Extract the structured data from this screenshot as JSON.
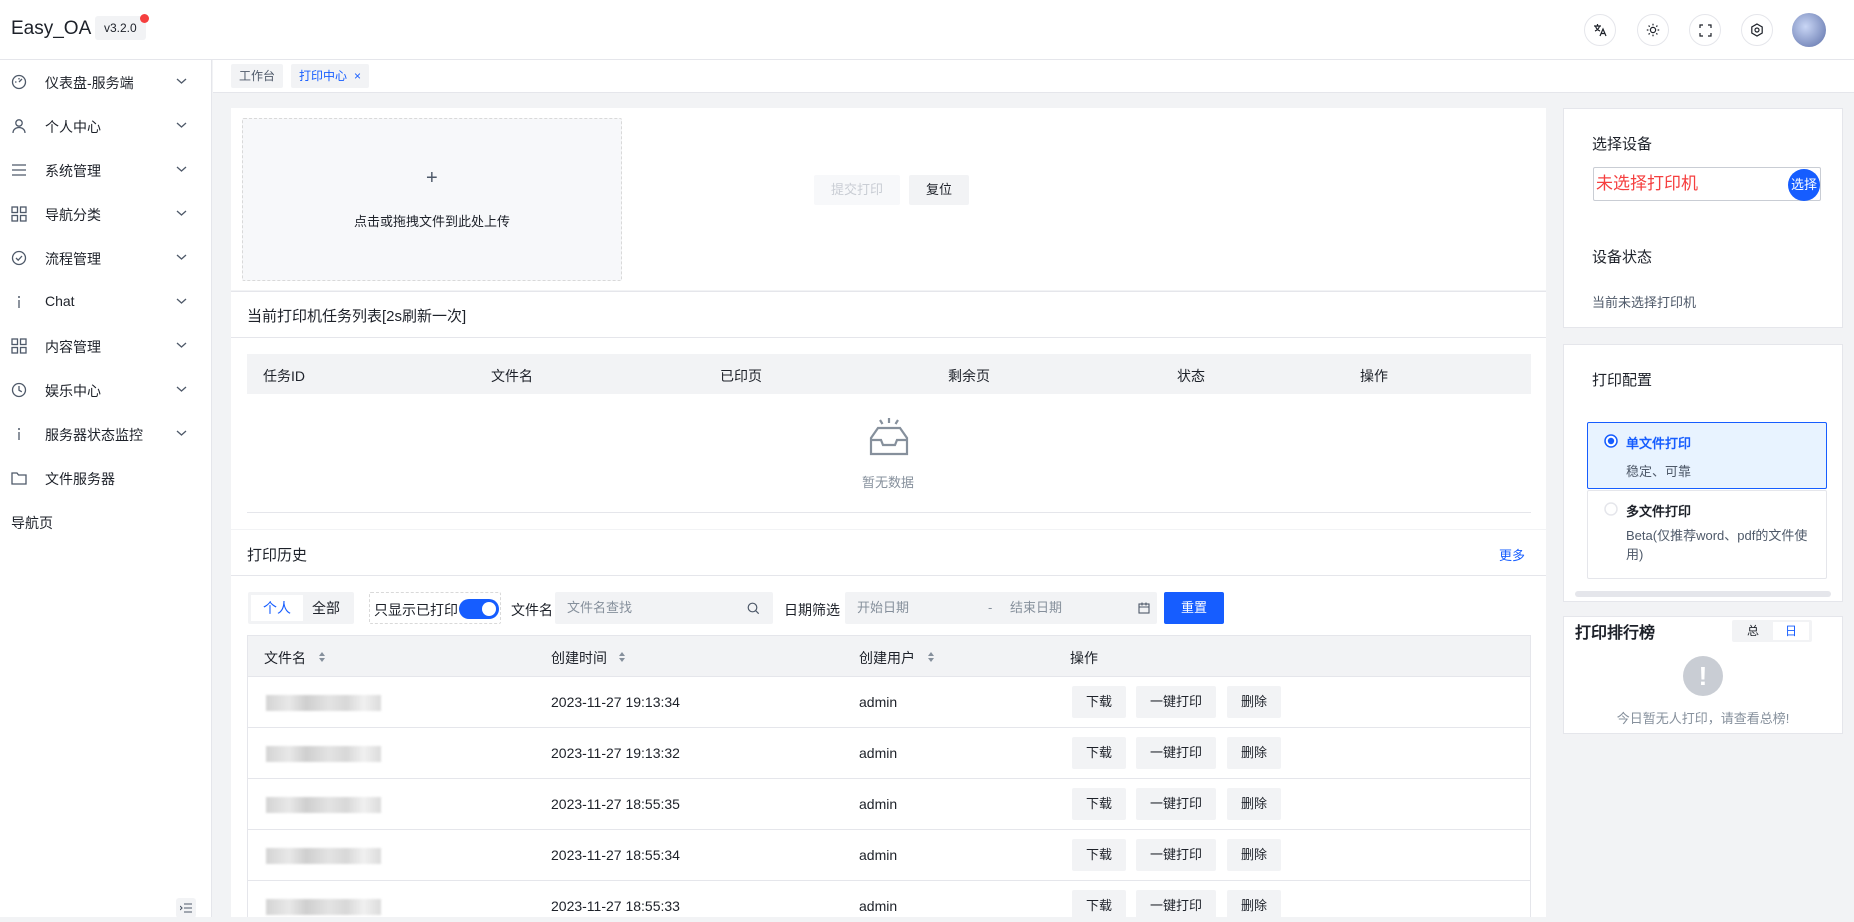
{
  "app": {
    "name": "Easy_OA",
    "version": "v3.2.0"
  },
  "header_icons": [
    "translate-icon",
    "theme-icon",
    "fullscreen-icon",
    "settings-icon"
  ],
  "sidebar": {
    "items": [
      {
        "label": "仪表盘-服务端",
        "icon": "dashboard-icon",
        "expandable": true
      },
      {
        "label": "个人中心",
        "icon": "user-icon",
        "expandable": true
      },
      {
        "label": "系统管理",
        "icon": "menu-icon",
        "expandable": true
      },
      {
        "label": "导航分类",
        "icon": "apps-icon",
        "expandable": true
      },
      {
        "label": "流程管理",
        "icon": "check-circle-icon",
        "expandable": true
      },
      {
        "label": "Chat",
        "icon": "info-icon",
        "expandable": true
      },
      {
        "label": "内容管理",
        "icon": "apps-icon",
        "expandable": true
      },
      {
        "label": "娱乐中心",
        "icon": "clock-icon",
        "expandable": true
      },
      {
        "label": "服务器状态监控",
        "icon": "info-icon",
        "expandable": true
      },
      {
        "label": "文件服务器",
        "icon": "folder-icon",
        "expandable": false
      }
    ],
    "nav_page": "导航页"
  },
  "tabs": [
    {
      "label": "工作台"
    },
    {
      "label": "打印中心",
      "active": true
    }
  ],
  "upload": {
    "plus": "+",
    "hint": "点击或拖拽文件到此处上传"
  },
  "actions": {
    "submit": "提交打印",
    "reset": "复位"
  },
  "task_list": {
    "title": "当前打印机任务列表[2s刷新一次]",
    "columns": [
      "任务ID",
      "文件名",
      "已印页",
      "剩余页",
      "状态",
      "操作"
    ],
    "empty": "暂无数据"
  },
  "history": {
    "title": "打印历史",
    "more": "更多",
    "scope_options": [
      "个人",
      "全部"
    ],
    "only_printed_label": "只显示已打印",
    "only_printed": true,
    "filename_label": "文件名",
    "filename_placeholder": "文件名查找",
    "date_label": "日期筛选",
    "start_placeholder": "开始日期",
    "date_sep": "-",
    "end_placeholder": "结束日期",
    "reset": "重置",
    "columns": [
      "文件名",
      "创建时间",
      "创建用户",
      "操作"
    ],
    "row_actions": [
      "下载",
      "一键打印",
      "删除"
    ],
    "rows": [
      {
        "created": "2023-11-27 19:13:34",
        "user": "admin"
      },
      {
        "created": "2023-11-27 19:13:32",
        "user": "admin"
      },
      {
        "created": "2023-11-27 18:55:35",
        "user": "admin"
      },
      {
        "created": "2023-11-27 18:55:34",
        "user": "admin"
      },
      {
        "created": "2023-11-27 18:55:33",
        "user": "admin"
      }
    ]
  },
  "device": {
    "title": "选择设备",
    "printer": "未选择打印机",
    "select_btn": "选择",
    "status_title": "设备状态",
    "status_text": "当前未选择打印机"
  },
  "config": {
    "title": "打印配置",
    "options": [
      {
        "title": "单文件打印",
        "desc": "稳定、可靠",
        "selected": true
      },
      {
        "title": "多文件打印",
        "desc": "Beta(仅推荐word、pdf的文件使用)",
        "selected": false
      }
    ]
  },
  "ranking": {
    "title": "打印排行榜",
    "tabs": [
      "总",
      "日"
    ],
    "active_tab": "日",
    "empty": "今日暂无人打印，请查看总榜!"
  },
  "colors": {
    "primary": "#165dff",
    "danger": "#f53f3f",
    "bg": "#f2f3f5"
  }
}
